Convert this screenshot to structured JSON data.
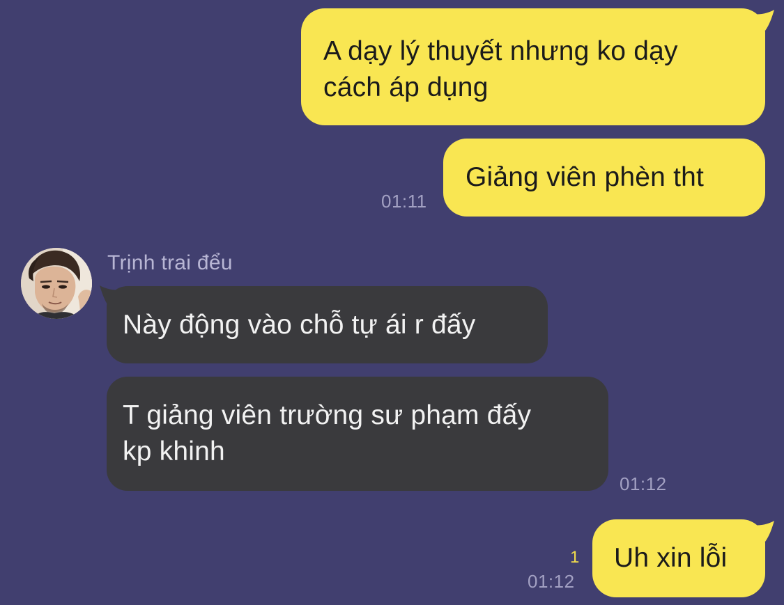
{
  "conversation": {
    "messages": [
      {
        "id": "m1",
        "direction": "outgoing",
        "text": "A dạy lý thuyết nhưng ko dạy\ncách áp dụng"
      },
      {
        "id": "m2",
        "direction": "outgoing",
        "text": "Giảng viên phèn tht",
        "time": "01:11"
      },
      {
        "id": "m3",
        "direction": "incoming",
        "sender": "Trịnh trai đểu",
        "text": "Này động vào chỗ tự ái r đấy"
      },
      {
        "id": "m4",
        "direction": "incoming",
        "text": "T giảng viên trường sư phạm đấy\nkp khinh",
        "time": "01:12"
      },
      {
        "id": "m5",
        "direction": "outgoing",
        "text": "Uh xin lỗi",
        "time": "01:12",
        "unread_count": "1"
      }
    ]
  },
  "theme": {
    "background": "#413f6f",
    "outgoing_bubble": "#f9e652",
    "incoming_bubble": "#3a3a3d",
    "timestamp": "#a3a1c3",
    "unread_indicator": "#f2dd4c"
  },
  "icons": {
    "avatar": "contact-avatar-photo"
  }
}
